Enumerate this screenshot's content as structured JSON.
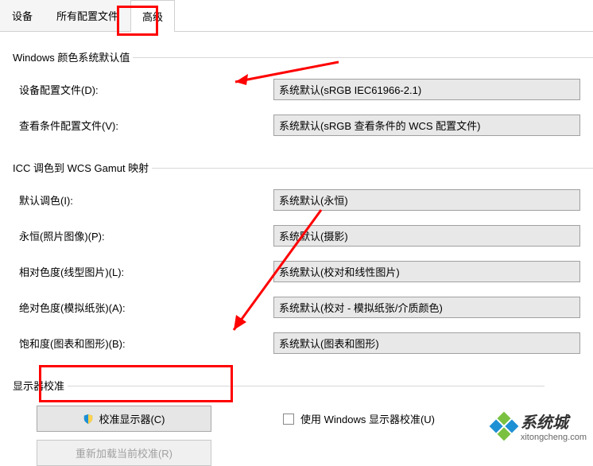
{
  "tabs": {
    "t0": "设备",
    "t1": "所有配置文件",
    "t2": "高级"
  },
  "group1": {
    "title": "Windows 颜色系统默认值",
    "row1_label": "设备配置文件(D):",
    "row1_value": "系统默认(sRGB IEC61966-2.1)",
    "row2_label": "查看条件配置文件(V):",
    "row2_value": "系统默认(sRGB 查看条件的 WCS 配置文件)"
  },
  "group2": {
    "title": "ICC 调色到 WCS Gamut 映射",
    "row1_label": "默认调色(I):",
    "row1_value": "系统默认(永恒)",
    "row2_label": "永恒(照片图像)(P):",
    "row2_value": "系统默认(摄影)",
    "row3_label": "相对色度(线型图片)(L):",
    "row3_value": "系统默认(校对和线性图片)",
    "row4_label": "绝对色度(模拟纸张)(A):",
    "row4_value": "系统默认(校对 - 模拟纸张/介质颜色)",
    "row5_label": "饱和度(图表和图形)(B):",
    "row5_value": "系统默认(图表和图形)"
  },
  "group3": {
    "title": "显示器校准",
    "calibrate_btn": "校准显示器(C)",
    "use_calib_label": "使用 Windows 显示器校准(U)",
    "reload_btn": "重新加载当前校准(R)"
  },
  "watermark": {
    "text_big": "系统城",
    "text_small": "xitongcheng.com"
  },
  "colors": {
    "wm_green": "#7ac142",
    "wm_blue": "#1e90d4"
  }
}
